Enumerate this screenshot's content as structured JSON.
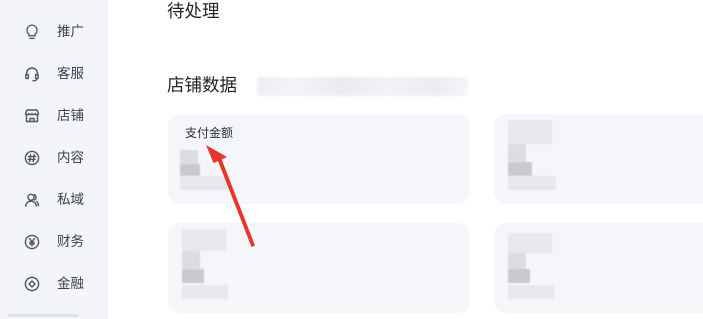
{
  "sidebar": {
    "items": [
      {
        "label": "推广",
        "icon": "lightbulb-icon"
      },
      {
        "label": "客服",
        "icon": "headset-icon"
      },
      {
        "label": "店铺",
        "icon": "store-icon"
      },
      {
        "label": "内容",
        "icon": "hash-icon"
      },
      {
        "label": "私域",
        "icon": "users-icon"
      },
      {
        "label": "财务",
        "icon": "yen-icon"
      },
      {
        "label": "金融",
        "icon": "finance-icon"
      }
    ]
  },
  "main": {
    "pending_title": "待处理",
    "store_data_title": "店铺数据",
    "cards": [
      {
        "label": "支付金额"
      },
      {
        "label": ""
      },
      {
        "label": ""
      },
      {
        "label": ""
      }
    ]
  },
  "colors": {
    "sidebar_bg": "#f3f5fa",
    "card_bg": "#f5f6f9",
    "arrow": "#e8342a"
  }
}
